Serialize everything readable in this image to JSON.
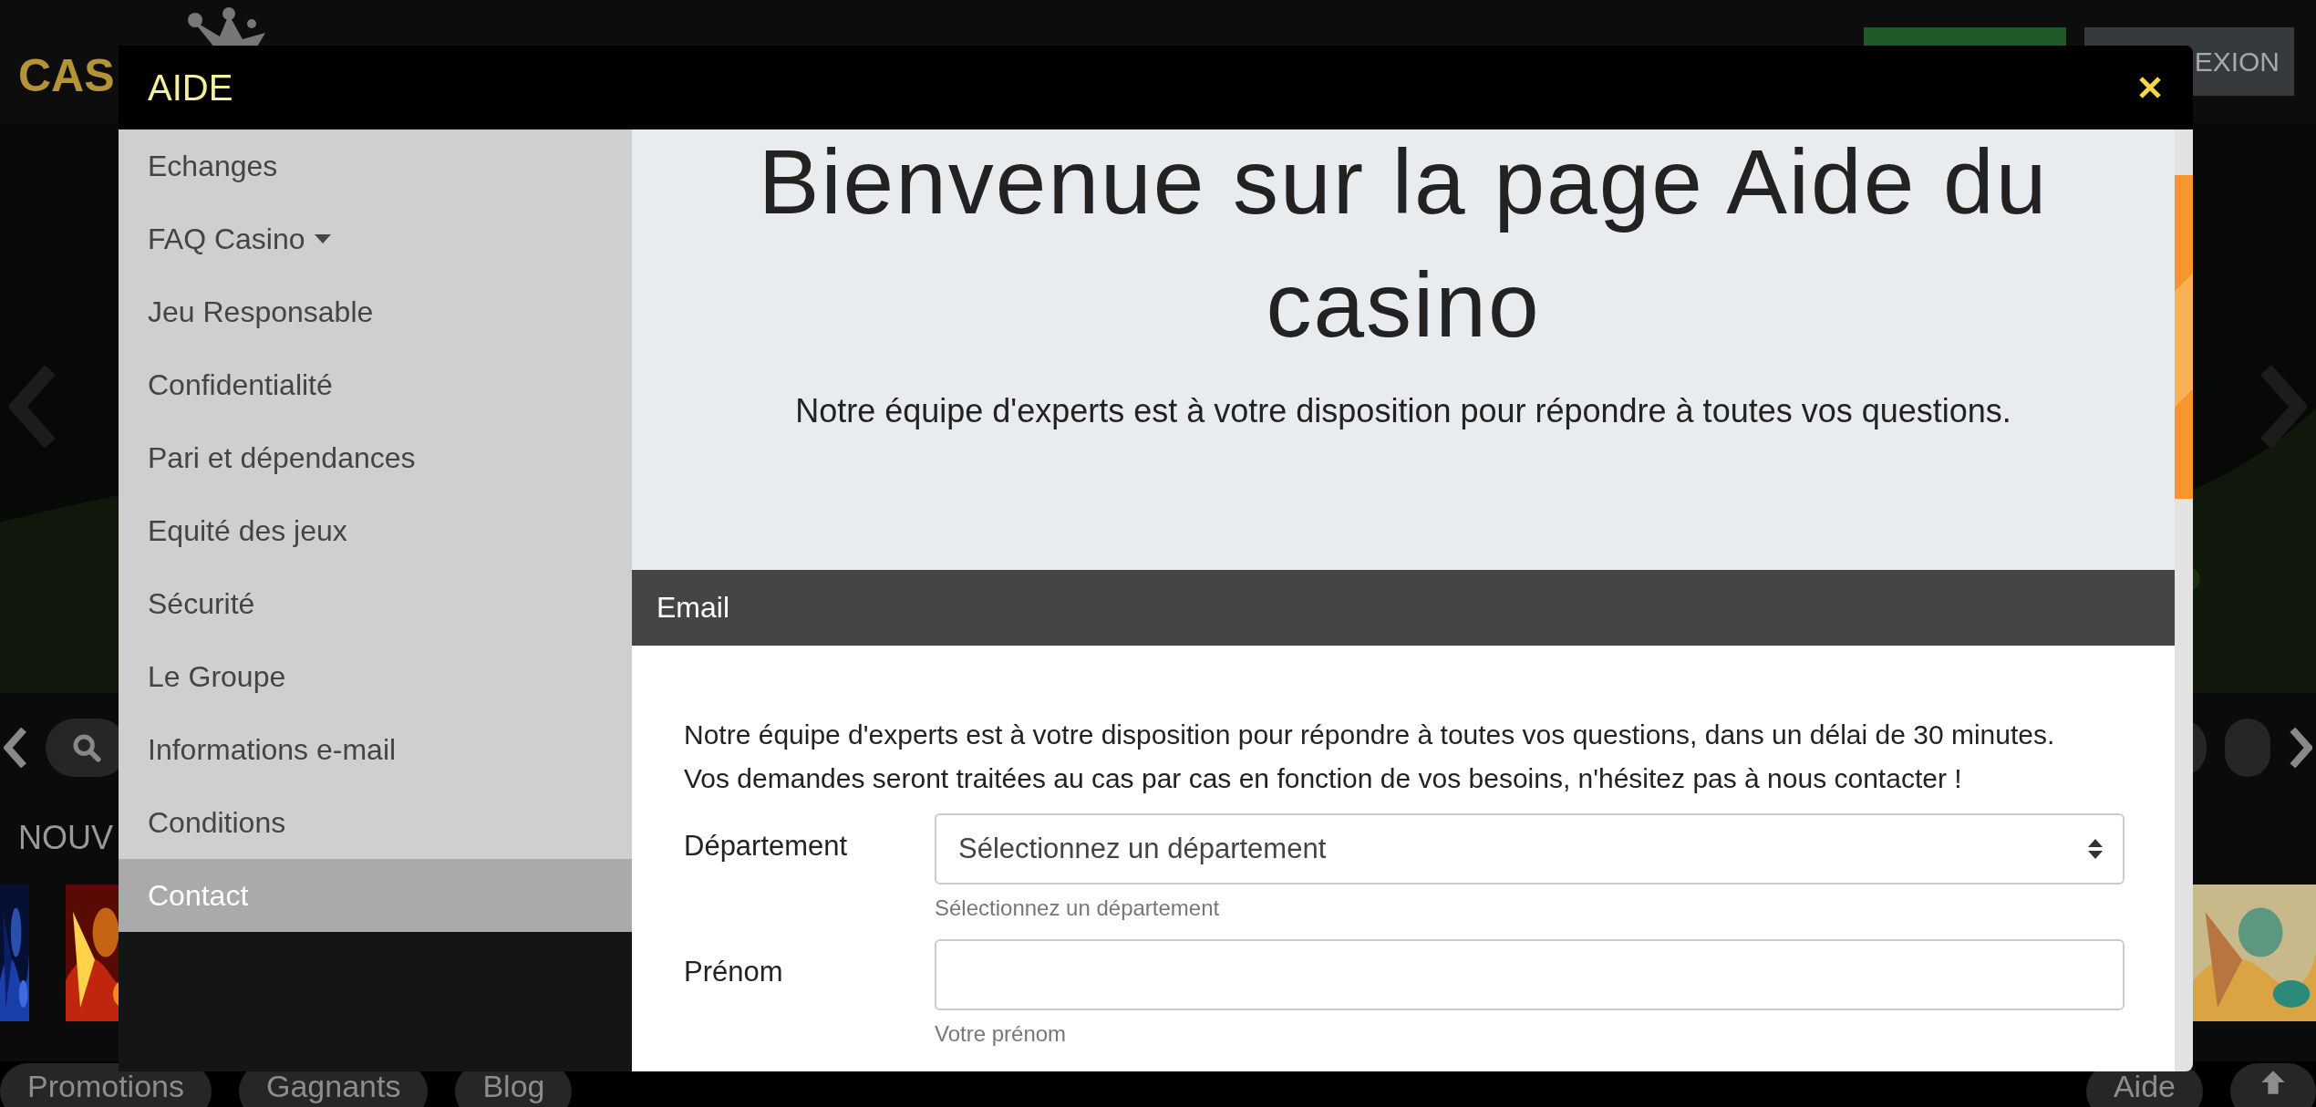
{
  "background": {
    "logo": "CAS",
    "connexion_button": "EXION",
    "section_heading": "NOUV",
    "bottom_links": [
      {
        "label": "Promotions"
      },
      {
        "label": "Gagnants"
      },
      {
        "label": "Blog"
      }
    ],
    "help_button": "Aide"
  },
  "modal": {
    "title": "AIDE",
    "sidebar": [
      {
        "label": "Echanges",
        "selected": false,
        "dropdown": false
      },
      {
        "label": "FAQ Casino",
        "selected": false,
        "dropdown": true
      },
      {
        "label": "Jeu Responsable",
        "selected": false,
        "dropdown": false
      },
      {
        "label": "Confidentialité",
        "selected": false,
        "dropdown": false
      },
      {
        "label": "Pari et dépendances",
        "selected": false,
        "dropdown": false
      },
      {
        "label": "Equité des jeux",
        "selected": false,
        "dropdown": false
      },
      {
        "label": "Sécurité",
        "selected": false,
        "dropdown": false
      },
      {
        "label": "Le Groupe",
        "selected": false,
        "dropdown": false
      },
      {
        "label": "Informations e-mail",
        "selected": false,
        "dropdown": false
      },
      {
        "label": "Conditions",
        "selected": false,
        "dropdown": false
      },
      {
        "label": "Contact",
        "selected": true,
        "dropdown": false
      }
    ],
    "hero": {
      "title": "Bienvenue sur la page Aide du casino",
      "subtitle": "Notre équipe d'experts est à votre disposition pour répondre à toutes vos questions."
    },
    "section_header": "Email",
    "intro": [
      "Notre équipe d'experts est à votre disposition pour répondre à toutes vos questions, dans un délai de 30 minutes.",
      "Vos demandes seront traitées au cas par cas en fonction de vos besoins, n'hésitez pas à nous contacter !"
    ],
    "form": [
      {
        "label": "Département",
        "kind": "select",
        "value": "Sélectionnez un département",
        "help": "Sélectionnez un département"
      },
      {
        "label": "Prénom",
        "kind": "text",
        "help": "Votre prénom"
      }
    ]
  }
}
